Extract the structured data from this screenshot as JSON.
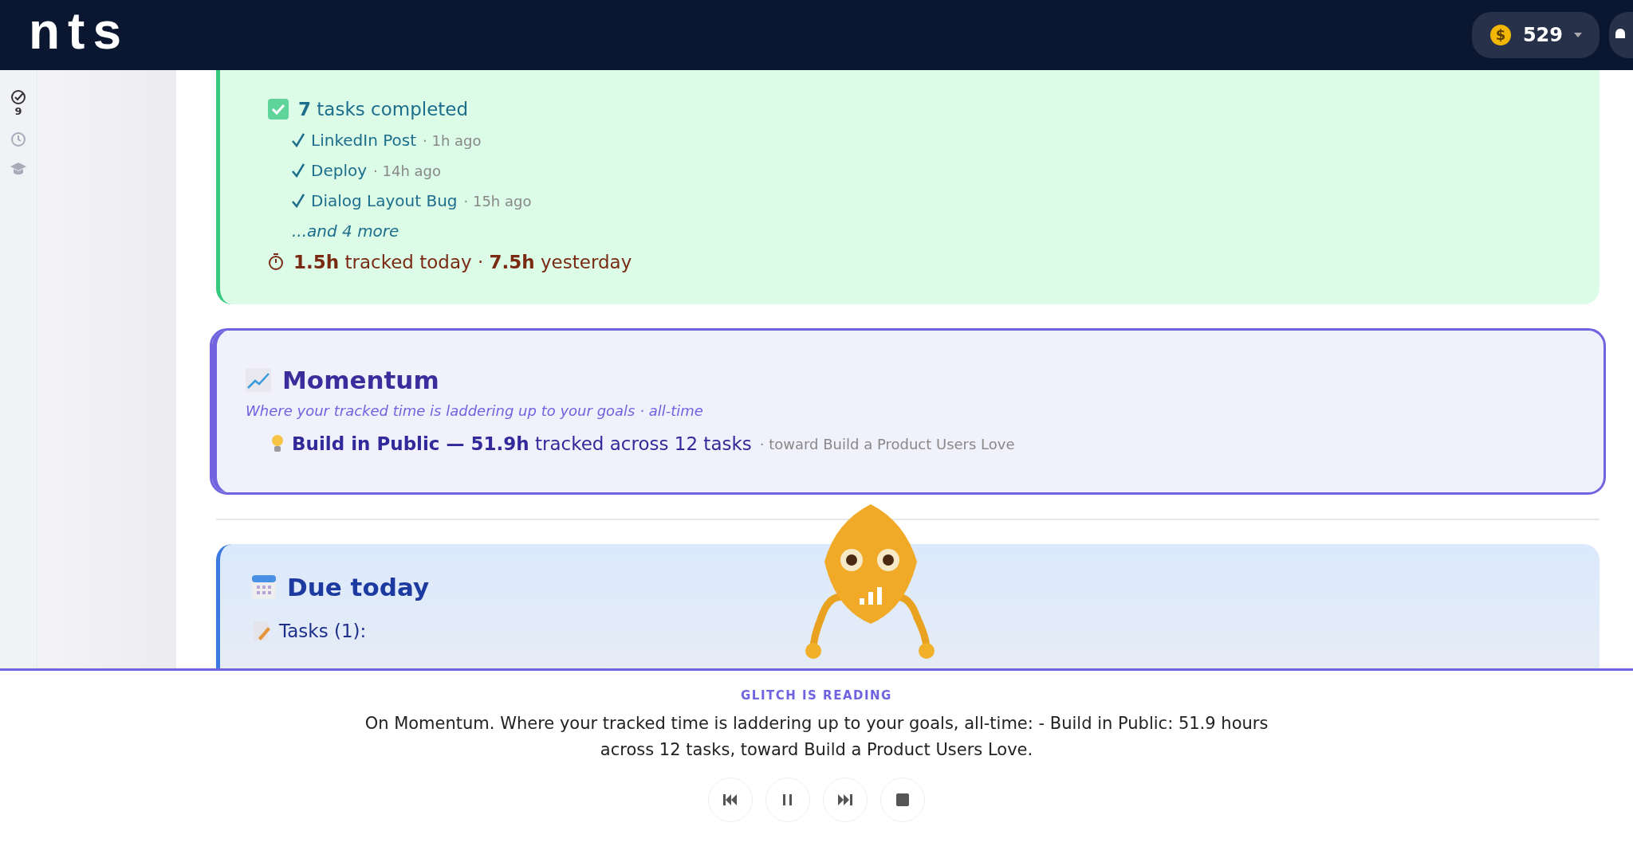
{
  "header": {
    "logo": "nts",
    "coin_symbol": "$",
    "coins": "529"
  },
  "sidebar": {
    "items": [
      {
        "kind": "tasks",
        "badge": "9",
        "selected": true
      },
      {
        "kind": "history",
        "selected": false
      },
      {
        "kind": "learn",
        "selected": false
      }
    ]
  },
  "recent": {
    "count": "7",
    "count_label": "tasks completed",
    "tasks": [
      {
        "name": "LinkedIn Post",
        "ago": "· 1h ago"
      },
      {
        "name": "Deploy",
        "ago": "· 14h ago"
      },
      {
        "name": "Dialog Layout Bug",
        "ago": "· 15h ago"
      }
    ],
    "more": "...and 4 more",
    "tracked": "**1.5h** tracked today · **7.5h** yesterday"
  },
  "momentum": {
    "title": "Momentum",
    "subtitle": "Where your tracked time is laddering up to your goals · all-time",
    "items": [
      {
        "text": "**Build in Public — 51.9h** tracked across 12 tasks",
        "goal": "· toward Build a Product Users Love"
      }
    ]
  },
  "due": {
    "title": "Due today",
    "tasks_label": "Tasks (1):"
  },
  "reader": {
    "label": "GLITCH IS READING",
    "text": "On Momentum. Where your tracked time is laddering up to your goals, all-time: - Build in Public: 51.9 hours across 12 tasks, toward Build a Product Users Love.",
    "controls": [
      {
        "kind": "previous"
      },
      {
        "kind": "pause"
      },
      {
        "kind": "next"
      },
      {
        "kind": "stop"
      }
    ]
  }
}
